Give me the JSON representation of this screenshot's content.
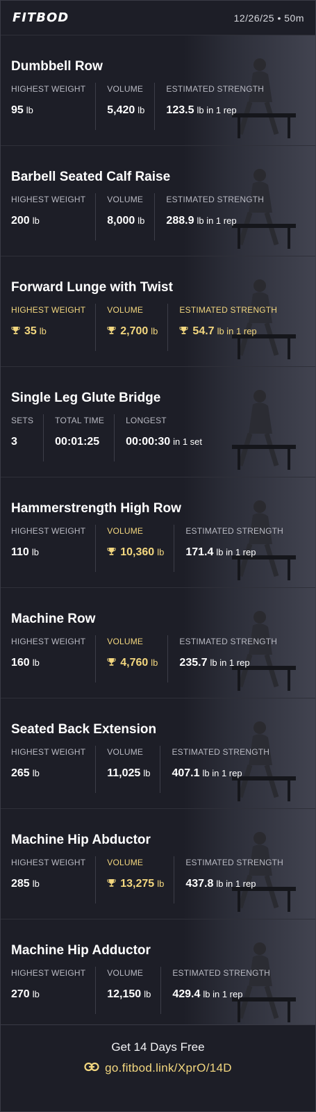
{
  "header": {
    "logo": "FITBOD",
    "date": "12/26/25",
    "separator": "•",
    "duration": "50m"
  },
  "colors": {
    "background": "#1d1e27",
    "gold": "#f3d77f",
    "label": "#b9bac3",
    "divider": "#3d3e49"
  },
  "exercises": [
    {
      "name": "Dumbbell Row",
      "stats": [
        {
          "label": "HIGHEST WEIGHT",
          "value": "95",
          "unit": "lb",
          "gold": false,
          "trophy": false
        },
        {
          "label": "VOLUME",
          "value": "5,420",
          "unit": "lb",
          "gold": false,
          "trophy": false
        },
        {
          "label": "ESTIMATED STRENGTH",
          "value": "123.5",
          "unit": "lb in 1 rep",
          "gold": false,
          "trophy": false
        }
      ]
    },
    {
      "name": "Barbell Seated Calf Raise",
      "stats": [
        {
          "label": "HIGHEST WEIGHT",
          "value": "200",
          "unit": "lb",
          "gold": false,
          "trophy": false
        },
        {
          "label": "VOLUME",
          "value": "8,000",
          "unit": "lb",
          "gold": false,
          "trophy": false
        },
        {
          "label": "ESTIMATED STRENGTH",
          "value": "288.9",
          "unit": "lb in 1 rep",
          "gold": false,
          "trophy": false
        }
      ]
    },
    {
      "name": "Forward Lunge with Twist",
      "stats": [
        {
          "label": "HIGHEST WEIGHT",
          "value": "35",
          "unit": "lb",
          "gold": true,
          "trophy": true
        },
        {
          "label": "VOLUME",
          "value": "2,700",
          "unit": "lb",
          "gold": true,
          "trophy": true
        },
        {
          "label": "ESTIMATED STRENGTH",
          "value": "54.7",
          "unit": "lb in 1 rep",
          "gold": true,
          "trophy": true
        }
      ]
    },
    {
      "name": "Single Leg Glute Bridge",
      "stats": [
        {
          "label": "SETS",
          "value": "3",
          "unit": "",
          "gold": false,
          "trophy": false
        },
        {
          "label": "TOTAL TIME",
          "value": "00:01:25",
          "unit": "",
          "gold": false,
          "trophy": false
        },
        {
          "label": "LONGEST",
          "value": "00:00:30",
          "unit": "in 1 set",
          "gold": false,
          "trophy": false
        }
      ]
    },
    {
      "name": "Hammerstrength High Row",
      "stats": [
        {
          "label": "HIGHEST WEIGHT",
          "value": "110",
          "unit": "lb",
          "gold": false,
          "trophy": false
        },
        {
          "label": "VOLUME",
          "value": "10,360",
          "unit": "lb",
          "gold": true,
          "trophy": true
        },
        {
          "label": "ESTIMATED STRENGTH",
          "value": "171.4",
          "unit": "lb in 1 rep",
          "gold": false,
          "trophy": false
        }
      ]
    },
    {
      "name": "Machine Row",
      "stats": [
        {
          "label": "HIGHEST WEIGHT",
          "value": "160",
          "unit": "lb",
          "gold": false,
          "trophy": false
        },
        {
          "label": "VOLUME",
          "value": "4,760",
          "unit": "lb",
          "gold": true,
          "trophy": true
        },
        {
          "label": "ESTIMATED STRENGTH",
          "value": "235.7",
          "unit": "lb in 1 rep",
          "gold": false,
          "trophy": false
        }
      ]
    },
    {
      "name": "Seated Back Extension",
      "stats": [
        {
          "label": "HIGHEST WEIGHT",
          "value": "265",
          "unit": "lb",
          "gold": false,
          "trophy": false
        },
        {
          "label": "VOLUME",
          "value": "11,025",
          "unit": "lb",
          "gold": false,
          "trophy": false
        },
        {
          "label": "ESTIMATED STRENGTH",
          "value": "407.1",
          "unit": "lb in 1 rep",
          "gold": false,
          "trophy": false
        }
      ]
    },
    {
      "name": "Machine Hip Abductor",
      "stats": [
        {
          "label": "HIGHEST WEIGHT",
          "value": "285",
          "unit": "lb",
          "gold": false,
          "trophy": false
        },
        {
          "label": "VOLUME",
          "value": "13,275",
          "unit": "lb",
          "gold": true,
          "trophy": true
        },
        {
          "label": "ESTIMATED STRENGTH",
          "value": "437.8",
          "unit": "lb in 1 rep",
          "gold": false,
          "trophy": false
        }
      ]
    },
    {
      "name": "Machine Hip Adductor",
      "stats": [
        {
          "label": "HIGHEST WEIGHT",
          "value": "270",
          "unit": "lb",
          "gold": false,
          "trophy": false
        },
        {
          "label": "VOLUME",
          "value": "12,150",
          "unit": "lb",
          "gold": false,
          "trophy": false
        },
        {
          "label": "ESTIMATED STRENGTH",
          "value": "429.4",
          "unit": "lb in 1 rep",
          "gold": false,
          "trophy": false
        }
      ]
    }
  ],
  "footer": {
    "cta": "Get 14 Days Free",
    "link": "go.fitbod.link/XprO/14D",
    "link_icon": "link-icon"
  }
}
